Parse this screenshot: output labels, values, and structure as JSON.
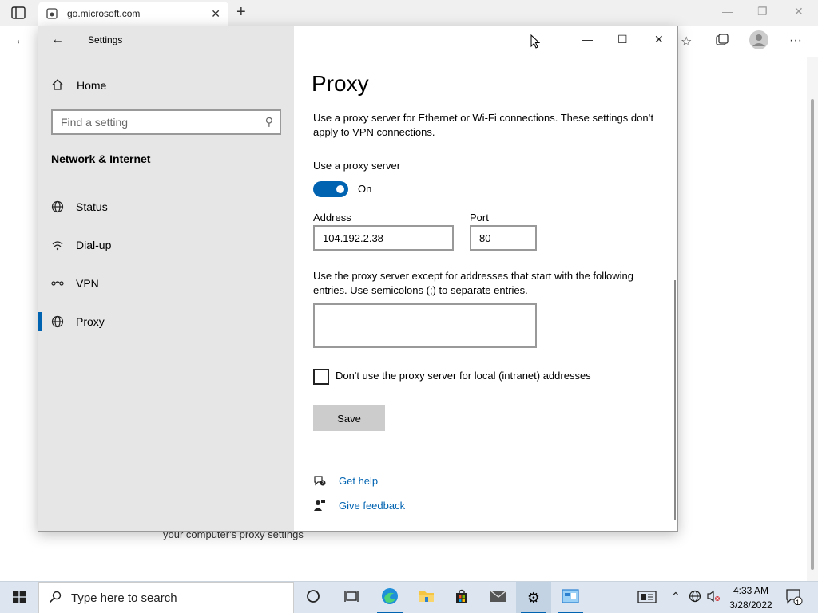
{
  "browser": {
    "tab_title": "go.microsoft.com",
    "page_text": "your computer's proxy settings"
  },
  "settings": {
    "window_title": "Settings",
    "sidebar": {
      "home_label": "Home",
      "search_placeholder": "Find a setting",
      "section_title": "Network & Internet",
      "items": [
        {
          "label": "Status",
          "icon": "globe-status-icon"
        },
        {
          "label": "Dial-up",
          "icon": "dialup-icon"
        },
        {
          "label": "VPN",
          "icon": "vpn-icon"
        },
        {
          "label": "Proxy",
          "icon": "globe-icon",
          "active": true
        }
      ]
    },
    "content": {
      "title": "Proxy",
      "intro": "Use a proxy server for Ethernet or Wi-Fi connections. These settings don’t apply to VPN connections.",
      "use_proxy_label": "Use a proxy server",
      "toggle_state": "On",
      "address_label": "Address",
      "address_value": "104.192.2.38",
      "port_label": "Port",
      "port_value": "80",
      "exceptions_desc": "Use the proxy server except for addresses that start with the following entries. Use semicolons (;) to separate entries.",
      "exceptions_value": "",
      "local_checkbox_label": "Don't use the proxy server for local (intranet) addresses",
      "local_checkbox_checked": false,
      "save_label": "Save",
      "help_label": "Get help",
      "feedback_label": "Give feedback"
    }
  },
  "taskbar": {
    "search_placeholder": "Type here to search",
    "time": "4:33 AM",
    "date": "3/28/2022",
    "notification_count": "1"
  },
  "colors": {
    "accent": "#0063b1",
    "sidebar_bg": "#e6e6e6",
    "taskbar_bg": "#dde6f0"
  }
}
